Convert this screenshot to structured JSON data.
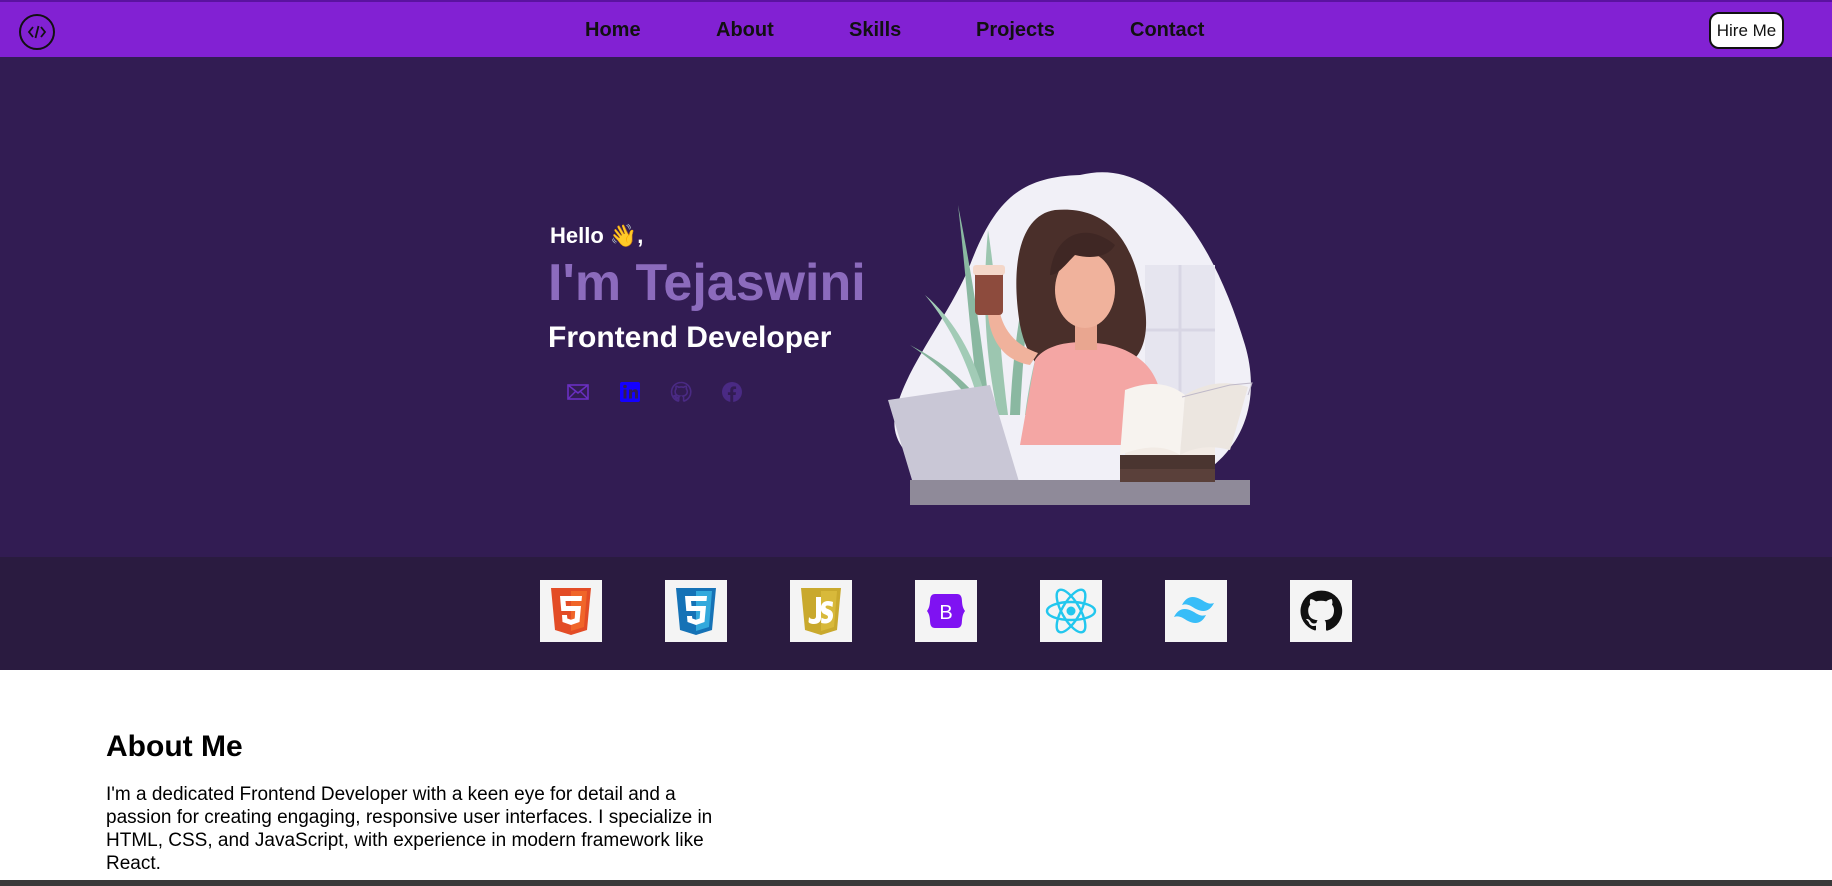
{
  "navbar": {
    "logo_icon": "code-brackets-icon",
    "links": [
      "Home",
      "About",
      "Skills",
      "Projects",
      "Contact"
    ],
    "hire_label": "Hire Me",
    "background": "#8221d3"
  },
  "hero": {
    "greeting": "Hello 👋,",
    "name": "I'm Tejaswini",
    "role": "Frontend Developer",
    "name_color": "#8c6bbd",
    "background": "#321c53",
    "socials": [
      "mail-icon",
      "linkedin-icon",
      "github-icon",
      "facebook-icon"
    ]
  },
  "skills": {
    "background": "#2a1b40",
    "icons": [
      "html5-icon",
      "css3-icon",
      "javascript-icon",
      "bootstrap-icon",
      "react-icon",
      "tailwind-icon",
      "github-icon"
    ]
  },
  "about": {
    "title": "About Me",
    "text": "I'm a dedicated Frontend Developer with a keen eye for detail and a passion for creating engaging, responsive user interfaces. I specialize in HTML, CSS, and JavaScript, with experience in modern framework like React."
  }
}
